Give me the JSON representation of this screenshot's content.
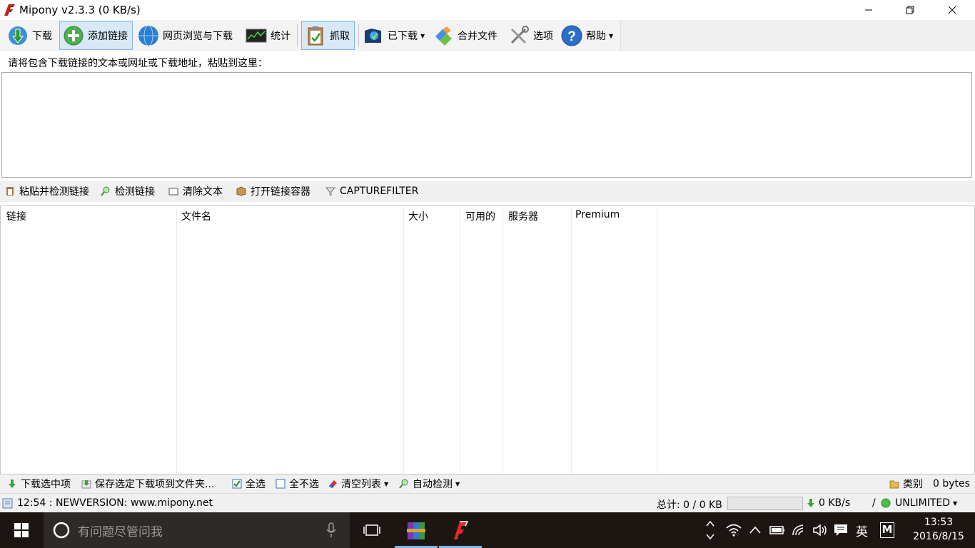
{
  "window": {
    "title": "Mipony v2.3.3 (0 KB/s)"
  },
  "toolbar": {
    "download": "下载",
    "add_link": "添加链接",
    "browse": "网页浏览与下载",
    "stats": "统计",
    "capture": "抓取",
    "downloaded": "已下载",
    "merge": "合并文件",
    "options": "选项",
    "help": "帮助"
  },
  "paste": {
    "label": "请将包含下载链接的文本或网址或下载地址，粘贴到这里：",
    "value": ""
  },
  "link_actions": {
    "paste_check": "粘贴并检测链接",
    "check": "检测链接",
    "clear": "清除文本",
    "open_container": "打开链接容器",
    "capture_filter": "CAPTUREFILTER"
  },
  "table": {
    "columns": [
      "链接",
      "文件名",
      "大小",
      "可用的",
      "服务器",
      "Premium"
    ],
    "rows": []
  },
  "bottom_actions": {
    "download_selected": "下载选中项",
    "save_selected": "保存选定下载项到文件夹...",
    "select_all": "全选",
    "select_none": "全不选",
    "clear_list": "清空列表",
    "auto_check": "自动检测",
    "category": "类别",
    "bytes": "0 bytes"
  },
  "status": {
    "message": "12:54 : NEWVERSION: www.mipony.net",
    "total": "总计: 0 / 0 KB",
    "speed": "0 KB/s",
    "slash": "/",
    "limit": "UNLIMITED"
  },
  "taskbar": {
    "search_placeholder": "有问题尽管问我",
    "ime": "英",
    "ime2": "M",
    "time": "13:53",
    "date": "2016/8/15"
  },
  "colors": {
    "accent": "#7eb4ea",
    "taskbar": "#1c1512",
    "search": "#2e2a28"
  }
}
